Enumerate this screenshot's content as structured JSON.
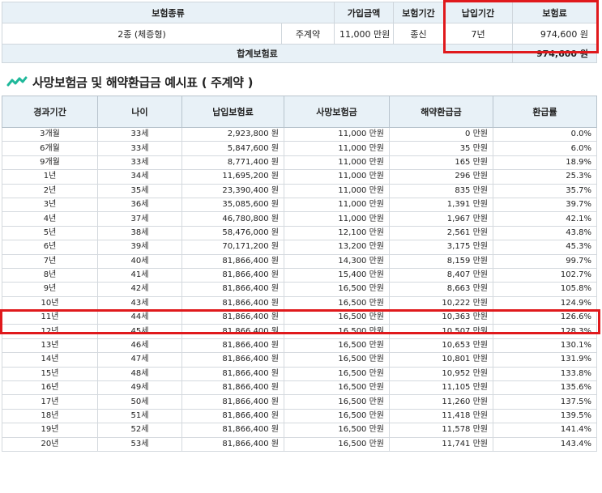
{
  "summary": {
    "headers": {
      "insurance_type": "보험종류",
      "coverage": "가입금액",
      "insurance_period": "보험기간",
      "payment_period": "납입기간",
      "premium": "보험료"
    },
    "row": {
      "type": "2종 (체증형)",
      "contract": "주계약",
      "coverage": "11,000 만원",
      "insurance_period": "종신",
      "payment_period": "7년",
      "premium": "974,600 원"
    },
    "total_label": "합계보험료",
    "total_value": "974,600 원"
  },
  "heading": "사망보험금 및 해약환급금 예시표 ( 주계약 )",
  "table": {
    "headers": [
      "경과기간",
      "나이",
      "납입보험료",
      "사망보험금",
      "해약환급금",
      "환급률"
    ],
    "rows": [
      [
        "3개월",
        "33세",
        "2,923,800 원",
        "11,000 만원",
        "0 만원",
        "0.0%"
      ],
      [
        "6개월",
        "33세",
        "5,847,600 원",
        "11,000 만원",
        "35 만원",
        "6.0%"
      ],
      [
        "9개월",
        "33세",
        "8,771,400 원",
        "11,000 만원",
        "165 만원",
        "18.9%"
      ],
      [
        "1년",
        "34세",
        "11,695,200 원",
        "11,000 만원",
        "296 만원",
        "25.3%"
      ],
      [
        "2년",
        "35세",
        "23,390,400 원",
        "11,000 만원",
        "835 만원",
        "35.7%"
      ],
      [
        "3년",
        "36세",
        "35,085,600 원",
        "11,000 만원",
        "1,391 만원",
        "39.7%"
      ],
      [
        "4년",
        "37세",
        "46,780,800 원",
        "11,000 만원",
        "1,967 만원",
        "42.1%"
      ],
      [
        "5년",
        "38세",
        "58,476,000 원",
        "12,100 만원",
        "2,561 만원",
        "43.8%"
      ],
      [
        "6년",
        "39세",
        "70,171,200 원",
        "13,200 만원",
        "3,175 만원",
        "45.3%"
      ],
      [
        "7년",
        "40세",
        "81,866,400 원",
        "14,300 만원",
        "8,159 만원",
        "99.7%"
      ],
      [
        "8년",
        "41세",
        "81,866,400 원",
        "15,400 만원",
        "8,407 만원",
        "102.7%"
      ],
      [
        "9년",
        "42세",
        "81,866,400 원",
        "16,500 만원",
        "8,663 만원",
        "105.8%"
      ],
      [
        "10년",
        "43세",
        "81,866,400 원",
        "16,500 만원",
        "10,222 만원",
        "124.9%"
      ],
      [
        "11년",
        "44세",
        "81,866,400 원",
        "16,500 만원",
        "10,363 만원",
        "126.6%"
      ],
      [
        "12년",
        "45세",
        "81,866,400 원",
        "16,500 만원",
        "10,507 만원",
        "128.3%"
      ],
      [
        "13년",
        "46세",
        "81,866,400 원",
        "16,500 만원",
        "10,653 만원",
        "130.1%"
      ],
      [
        "14년",
        "47세",
        "81,866,400 원",
        "16,500 만원",
        "10,801 만원",
        "131.9%"
      ],
      [
        "15년",
        "48세",
        "81,866,400 원",
        "16,500 만원",
        "10,952 만원",
        "133.8%"
      ],
      [
        "16년",
        "49세",
        "81,866,400 원",
        "16,500 만원",
        "11,105 만원",
        "135.6%"
      ],
      [
        "17년",
        "50세",
        "81,866,400 원",
        "16,500 만원",
        "11,260 만원",
        "137.5%"
      ],
      [
        "18년",
        "51세",
        "81,866,400 원",
        "16,500 만원",
        "11,418 만원",
        "139.5%"
      ],
      [
        "19년",
        "52세",
        "81,866,400 원",
        "16,500 만원",
        "11,578 만원",
        "141.4%"
      ],
      [
        "20년",
        "53세",
        "81,866,400 원",
        "16,500 만원",
        "11,741 만원",
        "143.4%"
      ]
    ]
  },
  "colors": {
    "header_bg": "#e8f1f7",
    "highlight": "#e0191c",
    "icon": "#1fb89a"
  },
  "icons": {
    "heading": "growth-wave-icon"
  }
}
